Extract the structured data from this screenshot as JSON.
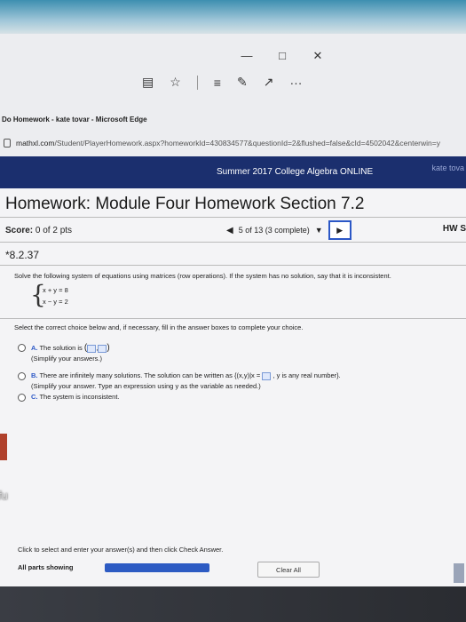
{
  "window": {
    "title": "Do Homework - kate tovar - Microsoft Edge",
    "controls": {
      "minimize": "—",
      "maximize": "□",
      "close": "✕"
    },
    "url_host": "mathxl.com",
    "url_path": "/Student/PlayerHomework.aspx?homeworkId=430834577&questionId=2&flushed=false&cId=4502042&centerwin=y"
  },
  "toolbar": {
    "icons": [
      "reading-view-icon",
      "favorites-icon",
      "hub-icon",
      "web-note-icon",
      "share-icon",
      "more-icon"
    ],
    "more_label": "···"
  },
  "site": {
    "course": "Summer 2017 College Algebra ONLINE",
    "user": "kate tova"
  },
  "homework": {
    "title": "Homework: Module Four Homework Section 7.2",
    "score_label": "Score:",
    "score_value": "0 of 2 pts",
    "progress_text": "5 of 13 (3 complete)",
    "hw_score_label": "HW S",
    "problem_id": "*8.2.37"
  },
  "problem": {
    "question": "Solve the following system of equations using matrices (row operations). If the system has no solution, say that it is inconsistent.",
    "equations": [
      "x + y = 8",
      "x − y = 2"
    ],
    "instruction": "Select the correct choice below and, if necessary, fill in the answer boxes to complete your choice.",
    "choices": [
      {
        "letter": "A.",
        "text": "The solution is",
        "sub": "(Simplify your answers.)"
      },
      {
        "letter": "B.",
        "text": "There are infinitely many solutions. The solution can be written as {(x,y)|x =",
        "text_after": ", y is any real number}.",
        "sub": "(Simplify your answer. Type an expression using y as the variable as needed.)"
      },
      {
        "letter": "C.",
        "text": "The system is inconsistent.",
        "sub": ""
      }
    ]
  },
  "footer": {
    "hint": "Click to select and enter your answer(s) and then click Check Answer.",
    "all_parts": "All parts showing",
    "clear_all": "Clear All",
    "progress_fraction": 1.0
  },
  "left_tab_text": "fu"
}
